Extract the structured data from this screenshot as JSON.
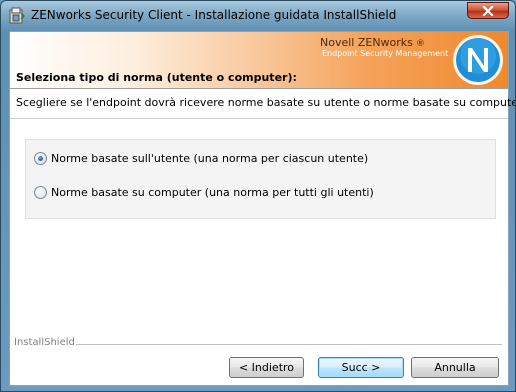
{
  "window": {
    "title": "ZENworks Security Client - Installazione guidata InstallShield",
    "close_icon": "close-icon",
    "app_icon": "installer-icon"
  },
  "banner": {
    "title": "Seleziona tipo di norma (utente o computer):",
    "brand_name": "Novell ZENworks",
    "brand_reg": "®",
    "brand_sub": "Endpoint Security Management",
    "logo_icon": "zenworks-logo-icon",
    "colors": {
      "orange": "#ef8a2c",
      "logo_blue": "#1e8fd6"
    }
  },
  "body": {
    "description": "Scegliere se l'endpoint dovrà ricevere norme basate su utente o norme basate su computer."
  },
  "options": [
    {
      "label": "Norme basate sull'utente (una norma per ciascun utente)",
      "selected": true
    },
    {
      "label": "Norme basate su computer (una norma per tutti gli utenti)",
      "selected": false
    }
  ],
  "footer": {
    "brand": "InstallShield",
    "back_label": "< Indietro",
    "next_label": "Succ >",
    "cancel_label": "Annulla"
  }
}
